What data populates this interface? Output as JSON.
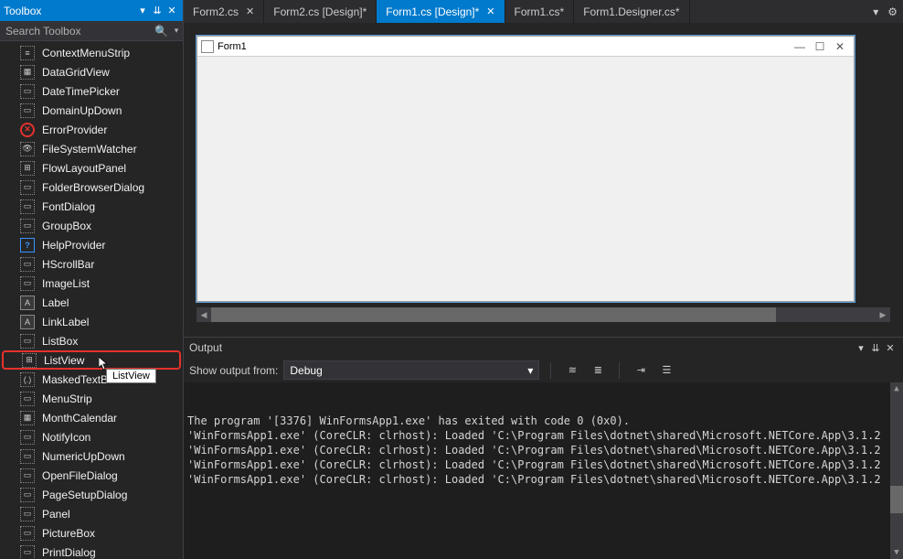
{
  "toolbox": {
    "title": "Toolbox",
    "search_placeholder": "Search Toolbox",
    "items": [
      {
        "label": "ContextMenuStrip",
        "icon": "≡"
      },
      {
        "label": "DataGridView",
        "icon": "▦"
      },
      {
        "label": "DateTimePicker",
        "icon": "▭"
      },
      {
        "label": "DomainUpDown",
        "icon": "▭"
      },
      {
        "label": "ErrorProvider",
        "icon": "✕",
        "iconClass": "round"
      },
      {
        "label": "FileSystemWatcher",
        "icon": "👁"
      },
      {
        "label": "FlowLayoutPanel",
        "icon": "⊞"
      },
      {
        "label": "FolderBrowserDialog",
        "icon": "▭"
      },
      {
        "label": "FontDialog",
        "icon": "▭"
      },
      {
        "label": "GroupBox",
        "icon": "▭"
      },
      {
        "label": "HelpProvider",
        "icon": "?",
        "iconClass": "blue"
      },
      {
        "label": "HScrollBar",
        "icon": "▭"
      },
      {
        "label": "ImageList",
        "icon": "▭"
      },
      {
        "label": "Label",
        "icon": "A",
        "iconClass": "solid"
      },
      {
        "label": "LinkLabel",
        "icon": "A",
        "iconClass": "solid"
      },
      {
        "label": "ListBox",
        "icon": "▭"
      },
      {
        "label": "ListView",
        "icon": "⊞",
        "highlighted": true,
        "tooltip": "ListView"
      },
      {
        "label": "MaskedTextBox",
        "icon": "(.)"
      },
      {
        "label": "MenuStrip",
        "icon": "▭"
      },
      {
        "label": "MonthCalendar",
        "icon": "▦"
      },
      {
        "label": "NotifyIcon",
        "icon": "▭"
      },
      {
        "label": "NumericUpDown",
        "icon": "▭"
      },
      {
        "label": "OpenFileDialog",
        "icon": "▭"
      },
      {
        "label": "PageSetupDialog",
        "icon": "▭"
      },
      {
        "label": "Panel",
        "icon": "▭"
      },
      {
        "label": "PictureBox",
        "icon": "▭"
      },
      {
        "label": "PrintDialog",
        "icon": "▭"
      }
    ]
  },
  "tabs": [
    {
      "label": "Form2.cs",
      "has_close": true
    },
    {
      "label": "Form2.cs [Design]*"
    },
    {
      "label": "Form1.cs [Design]*",
      "active": true,
      "has_close": true
    },
    {
      "label": "Form1.cs*"
    },
    {
      "label": "Form1.Designer.cs*"
    }
  ],
  "form": {
    "title": "Form1"
  },
  "output": {
    "title": "Output",
    "show_label": "Show output from:",
    "source": "Debug",
    "lines": [
      "'WinFormsApp1.exe' (CoreCLR: clrhost): Loaded 'C:\\Program Files\\dotnet\\shared\\Microsoft.NETCore.App\\3.1.2",
      "'WinFormsApp1.exe' (CoreCLR: clrhost): Loaded 'C:\\Program Files\\dotnet\\shared\\Microsoft.NETCore.App\\3.1.2",
      "'WinFormsApp1.exe' (CoreCLR: clrhost): Loaded 'C:\\Program Files\\dotnet\\shared\\Microsoft.NETCore.App\\3.1.2",
      "'WinFormsApp1.exe' (CoreCLR: clrhost): Loaded 'C:\\Program Files\\dotnet\\shared\\Microsoft.NETCore.App\\3.1.2",
      "The program '[3376] WinFormsApp1.exe' has exited with code 0 (0x0)."
    ]
  }
}
